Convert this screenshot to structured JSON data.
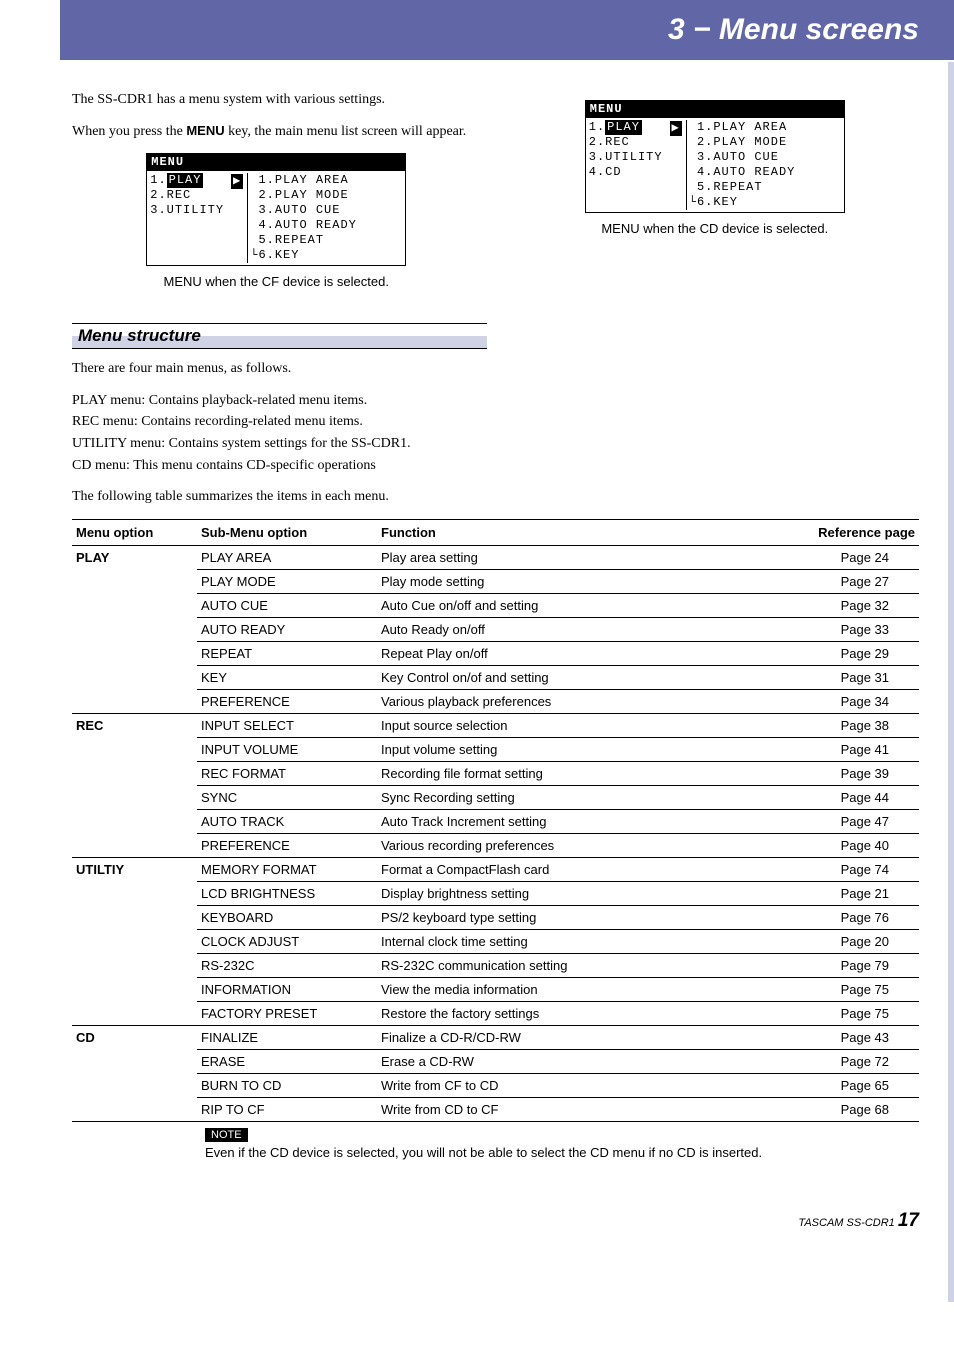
{
  "header": {
    "title": "3 − Menu screens"
  },
  "intro": {
    "line1_a": "The SS-CDR1 has a menu system with various settings.",
    "line2_a": "When you press the ",
    "line2_b": "MENU",
    "line2_c": " key, the main menu list screen will appear."
  },
  "lcd_caption_left": "MENU when the CF device is selected.",
  "lcd_caption_right": "MENU when the CD device is selected.",
  "lcd": {
    "title": "MENU",
    "left_cf": [
      "1.PLAY",
      "2.REC",
      "3.UTILITY"
    ],
    "left_cd": [
      "1.PLAY",
      "2.REC",
      "3.UTILITY",
      "4.CD"
    ],
    "right": [
      "1.PLAY AREA",
      "2.PLAY MODE",
      "3.AUTO CUE",
      "4.AUTO READY",
      "5.REPEAT",
      "6.KEY"
    ]
  },
  "section": {
    "structure": "Menu structure"
  },
  "structure_intro": "There are four main menus, as follows.",
  "menu_desc": [
    "PLAY menu: Contains playback-related menu items.",
    "REC menu: Contains recording-related menu items.",
    "UTILITY menu: Contains system settings for the SS-CDR1.",
    "CD menu: This menu contains CD-specific operations"
  ],
  "table_intro": "The following table summarizes the items in each menu.",
  "table": {
    "headers": [
      "Menu option",
      "Sub-Menu option",
      "Function",
      "Reference page"
    ],
    "groups": [
      {
        "menu": "PLAY",
        "rows": [
          [
            "PLAY AREA",
            "Play area setting",
            "Page 24"
          ],
          [
            "PLAY MODE",
            "Play mode setting",
            "Page 27"
          ],
          [
            "AUTO CUE",
            "Auto Cue on/off and setting",
            "Page 32"
          ],
          [
            "AUTO READY",
            "Auto Ready on/off",
            "Page 33"
          ],
          [
            "REPEAT",
            "Repeat Play on/off",
            "Page 29"
          ],
          [
            "KEY",
            "Key Control on/of and setting",
            "Page 31"
          ],
          [
            "PREFERENCE",
            "Various playback preferences",
            "Page 34"
          ]
        ]
      },
      {
        "menu": "REC",
        "rows": [
          [
            "INPUT SELECT",
            "Input source selection",
            "Page 38"
          ],
          [
            "INPUT VOLUME",
            "Input volume setting",
            "Page 41"
          ],
          [
            "REC FORMAT",
            "Recording file format setting",
            "Page 39"
          ],
          [
            "SYNC",
            "Sync Recording setting",
            "Page 44"
          ],
          [
            "AUTO TRACK",
            "Auto Track Increment setting",
            "Page 47"
          ],
          [
            "PREFERENCE",
            "Various recording preferences",
            "Page 40"
          ]
        ]
      },
      {
        "menu": "UTILTIY",
        "rows": [
          [
            "MEMORY FORMAT",
            "Format a CompactFlash card",
            "Page 74"
          ],
          [
            "LCD BRIGHTNESS",
            "Display brightness setting",
            "Page 21"
          ],
          [
            "KEYBOARD",
            "PS/2 keyboard type setting",
            "Page 76"
          ],
          [
            "CLOCK ADJUST",
            "Internal clock time setting",
            "Page 20"
          ],
          [
            "RS-232C",
            "RS-232C communication setting",
            "Page 79"
          ],
          [
            "INFORMATION",
            "View the media information",
            "Page 75"
          ],
          [
            "FACTORY PRESET",
            "Restore the factory settings",
            "Page 75"
          ]
        ]
      },
      {
        "menu": "CD",
        "rows": [
          [
            "FINALIZE",
            "Finalize a CD-R/CD-RW",
            "Page 43"
          ],
          [
            "ERASE",
            "Erase a CD-RW",
            "Page 72"
          ],
          [
            "BURN TO CD",
            "Write from CF to CD",
            "Page 65"
          ],
          [
            "RIP TO CF",
            "Write from CD to CF",
            "Page 68"
          ]
        ]
      }
    ]
  },
  "note": {
    "label": "NOTE",
    "text": "Even if the CD device is selected, you will not be able to select the CD menu if no CD is inserted."
  },
  "footer": {
    "brand": "TASCAM SS-CDR1",
    "page": "17"
  }
}
